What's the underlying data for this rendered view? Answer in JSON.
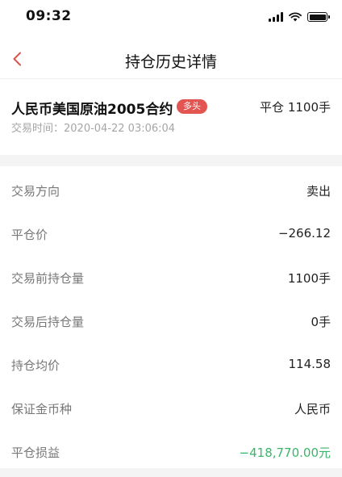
{
  "status_bar": {
    "time": "09:32"
  },
  "nav": {
    "title": "持仓历史详情"
  },
  "summary": {
    "contract_name": "人民币美国原油2005合约",
    "badge": "多头",
    "close_summary": "平仓 1100手",
    "trade_time": "交易时间：2020-04-22 03:06:04"
  },
  "details": {
    "direction": {
      "label": "交易方向",
      "value": "卖出"
    },
    "close_price": {
      "label": "平仓价",
      "value": "−266.12"
    },
    "before_position": {
      "label": "交易前持仓量",
      "value": "1100手"
    },
    "after_position": {
      "label": "交易后持仓量",
      "value": "0手"
    },
    "avg_price": {
      "label": "持仓均价",
      "value": "114.58"
    },
    "margin_currency": {
      "label": "保证金币种",
      "value": "人民币"
    },
    "profit": {
      "label": "平仓损益",
      "value": "−418,770.00元"
    }
  },
  "colors": {
    "badge": "#e25550",
    "back_arrow": "#d9534f",
    "profit": "#3bb56a"
  },
  "icons": {
    "back": "chevron-left-icon",
    "signal": "cellular-signal-icon",
    "wifi": "wifi-icon",
    "battery": "battery-icon"
  }
}
